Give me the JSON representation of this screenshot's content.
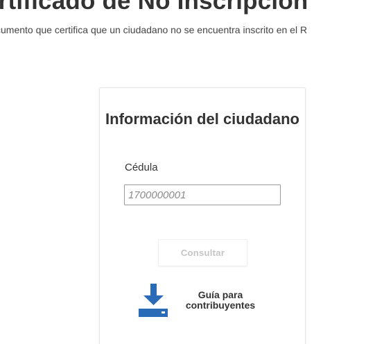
{
  "header": {
    "title": "ertificado de No Inscripción",
    "subtitle": "cumento que certifica que un ciudadano no se encuentra inscrito en el R"
  },
  "card": {
    "title": "Información del ciudadano",
    "cedula_label": "Cédula",
    "cedula_placeholder": "1700000001",
    "cedula_value": "",
    "consult_label": "Consultar",
    "guide_line1": "Guía para",
    "guide_line2": "contribuyentes"
  },
  "icons": {
    "download": "download-icon"
  },
  "colors": {
    "accent_blue": "#2a6bb8",
    "title_text": "#333333",
    "disabled_button_text": "#c4c4c4",
    "input_border": "#9a9a9a"
  }
}
